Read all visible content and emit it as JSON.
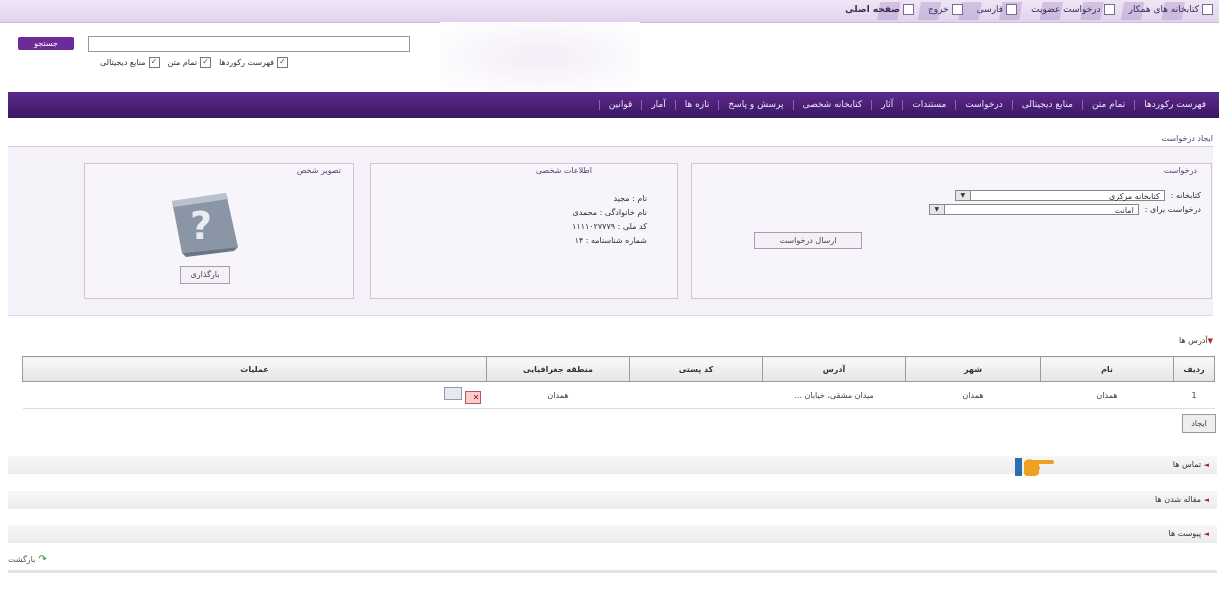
{
  "top_links": [
    {
      "label": "صفحه اصلی",
      "icon": "home-icon"
    },
    {
      "label": "خروج",
      "icon": "exit-icon"
    },
    {
      "label": "فارسی",
      "icon": "language-icon"
    },
    {
      "label": "درخواست عضویت",
      "icon": "membership-icon"
    },
    {
      "label": "کتابخانه های همکار",
      "icon": "library-icon"
    }
  ],
  "search": {
    "button_label": "جستجو",
    "input_value": "",
    "options": [
      {
        "label": "فهرست رکوردها",
        "checked": true
      },
      {
        "label": "تمام متن",
        "checked": true
      },
      {
        "label": "منابع دیجیتالی",
        "checked": true
      }
    ]
  },
  "nav": [
    "فهرست رکوردها",
    "تمام متن",
    "منابع دیجیتالی",
    "درخواست",
    "مستندات",
    "آثار",
    "کتابخانه شخصی",
    "پرسش و پاسخ",
    "تازه ها",
    "آمار",
    "قوانین"
  ],
  "breadcrumb": "ایجاد درخواست",
  "request": {
    "title": "درخواست",
    "library_label": "کتابخانه :",
    "library_value": "کتابخانه مرکزی",
    "type_label": "درخواست برای :",
    "type_value": "امانت",
    "submit_label": "ارسال درخواست"
  },
  "personal": {
    "title": "اطلاعات شخصی",
    "rows": [
      "نام : مجید",
      "نام خانوادگی : محمدی",
      "کد ملی : ۱۱۱۱۰۲۷۷۷۹",
      "شماره شناسنامه : ۱۴"
    ]
  },
  "photo": {
    "title": "تصویر شخص",
    "button_label": "بارگذاری"
  },
  "addresses": {
    "header": "آدرس ها",
    "columns": [
      "ردیف",
      "نام",
      "شهر",
      "آدرس",
      "کد پستی",
      "منطقه جغرافیایی",
      "عملیات"
    ],
    "rows": [
      {
        "num": "1",
        "name": "همدان",
        "city": "همدان",
        "address": "میدان مشقی، خیابان ...",
        "postal": "",
        "region": "همدان"
      }
    ],
    "add_label": "ایجاد"
  },
  "sections": [
    "تماس ها",
    "مقاله شدن ها",
    "پیوست ها"
  ],
  "back_label": "بازگشت",
  "colors": {
    "nav_bg": "#4a1f78",
    "accent": "#6d2b9a",
    "marker": "#b22222",
    "pointer": "#f0a020"
  }
}
